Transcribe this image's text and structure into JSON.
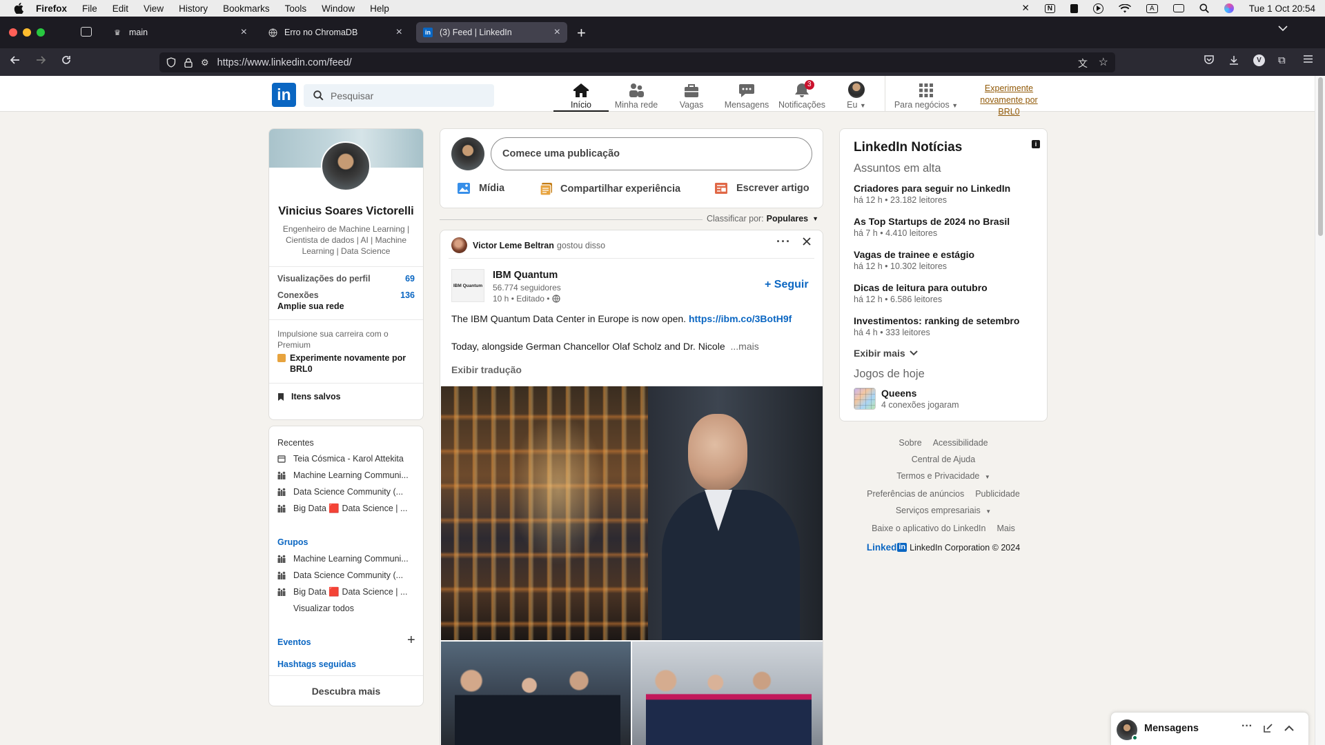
{
  "mac": {
    "app": "Firefox",
    "menu": [
      "File",
      "Edit",
      "View",
      "History",
      "Bookmarks",
      "Tools",
      "Window",
      "Help"
    ],
    "datetime": "Tue 1 Oct  20:54"
  },
  "browser": {
    "tabs": [
      {
        "title": "main",
        "active": false
      },
      {
        "title": "Erro no ChromaDB",
        "active": false
      },
      {
        "title": "(3) Feed | LinkedIn",
        "active": true
      }
    ],
    "url": "https://www.linkedin.com/feed/"
  },
  "linkedin": {
    "search_placeholder": "Pesquisar",
    "nav": [
      {
        "label": "Início",
        "active": true,
        "icon": "home-icon"
      },
      {
        "label": "Minha rede",
        "icon": "network-icon"
      },
      {
        "label": "Vagas",
        "icon": "briefcase-icon"
      },
      {
        "label": "Mensagens",
        "icon": "chat-icon"
      },
      {
        "label": "Notificações",
        "badge": "3",
        "icon": "bell-icon"
      },
      {
        "label": "Eu",
        "icon": "avatar"
      },
      {
        "label": "Para negócios",
        "icon": "grid-icon"
      }
    ],
    "premium_line1": "Experimente",
    "premium_line2": "novamente por BRL0",
    "accent": "#0a66c2",
    "premium_color": "#915907"
  },
  "profile": {
    "name": "Vinicius Soares Victorelli",
    "headline": "Engenheiro de Machine Learning | Cientista de dados | AI | Machine Learning | Data Science",
    "stats": [
      {
        "label": "Visualizações do perfil",
        "value": "69"
      },
      {
        "label": "Conexões",
        "value": "136"
      }
    ],
    "grow": "Amplie sua rede",
    "premium_text": "Impulsione sua carreira com o Premium",
    "premium_cta": "Experimente novamente por BRL0",
    "saved": "Itens salvos"
  },
  "sidebar": {
    "recent_title": "Recentes",
    "recent": [
      "Teia Cósmica - Karol Attekita",
      "Machine Learning Communi...",
      "Data Science Community (...",
      "Big Data 🟥 Data Science | ..."
    ],
    "groups_title": "Grupos",
    "groups": [
      "Machine Learning Communi...",
      "Data Science Community (...",
      "Big Data 🟥 Data Science | ..."
    ],
    "view_all": "Visualizar todos",
    "events": "Eventos",
    "hashtags": "Hashtags seguidas",
    "discover": "Descubra mais"
  },
  "composer": {
    "placeholder": "Comece uma publicação",
    "actions": [
      "Mídia",
      "Compartilhar experiência",
      "Escrever artigo"
    ],
    "sort_label": "Classificar por:",
    "sort_value": "Populares"
  },
  "post": {
    "liker": "Victor Leme Beltran",
    "liker_action": "gostou disso",
    "company": "IBM Quantum",
    "company_logo_text": "IBM Quantum",
    "followers": "56.774 seguidores",
    "time": "10 h • Editado •",
    "follow": "+ Seguir",
    "text1": "The IBM Quantum Data Center in Europe is now open.",
    "link": "https://ibm.co/3BotH9f",
    "text2": "Today, alongside German Chancellor Olaf Scholz and Dr. Nicole",
    "more": "...mais",
    "translate": "Exibir tradução"
  },
  "news": {
    "title": "LinkedIn Notícias",
    "subtitle": "Assuntos em alta",
    "items": [
      {
        "h": "Criadores para seguir no LinkedIn",
        "s": "há 12 h • 23.182 leitores"
      },
      {
        "h": "As Top Startups de 2024 no Brasil",
        "s": "há 7 h • 4.410 leitores"
      },
      {
        "h": "Vagas de trainee e estágio",
        "s": "há 12 h • 10.302 leitores"
      },
      {
        "h": "Dicas de leitura para outubro",
        "s": "há 12 h • 6.586 leitores"
      },
      {
        "h": "Investimentos: ranking de setembro",
        "s": "há 4 h • 333 leitores"
      }
    ],
    "show_more": "Exibir mais",
    "games_title": "Jogos de hoje",
    "game_name": "Queens",
    "game_sub": "4 conexões jogaram"
  },
  "footer": {
    "row1": [
      "Sobre",
      "Acessibilidade"
    ],
    "row2": "Central de Ajuda",
    "row3": "Termos e Privacidade",
    "row4": [
      "Preferências de anúncios",
      "Publicidade"
    ],
    "row5": "Serviços empresariais",
    "row6": [
      "Baixe o aplicativo do LinkedIn",
      "Mais"
    ],
    "brand": "Linked",
    "brand_in": "in",
    "copyright": "LinkedIn Corporation © 2024"
  },
  "messaging": {
    "label": "Mensagens"
  }
}
